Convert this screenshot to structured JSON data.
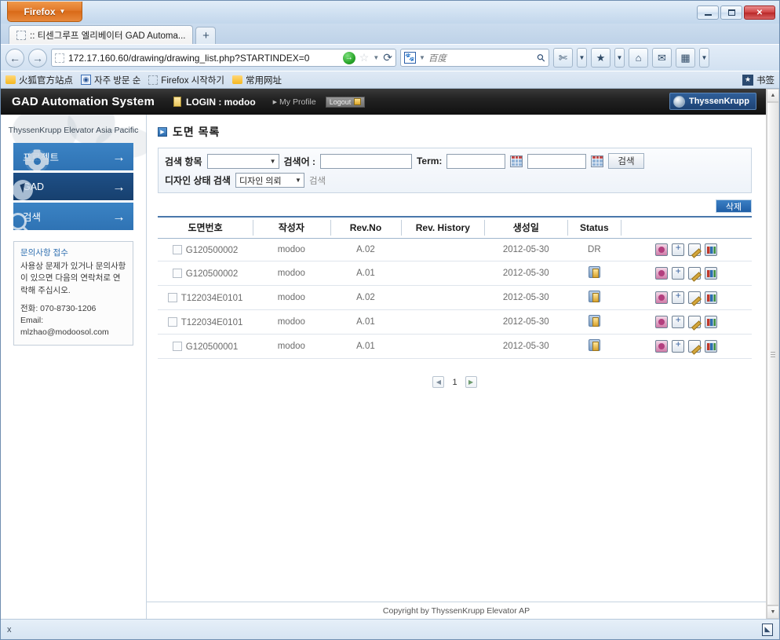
{
  "browser": {
    "app_button": "Firefox",
    "tab_title": ":: 티센그루프 엘리베이터 GAD Automa...",
    "new_tab_label": "+",
    "url": "172.17.160.60/drawing/drawing_list.php?STARTINDEX=0",
    "search_engine": "baidu",
    "search_placeholder": "百度",
    "bookmarks": [
      {
        "label": "火狐官方站点",
        "icon": "folder-icon"
      },
      {
        "label": "자주 방문 순",
        "icon": "bookmark-icon"
      },
      {
        "label": "Firefox 시작하기",
        "icon": "page-icon"
      },
      {
        "label": "常用网址",
        "icon": "folder-icon"
      }
    ],
    "bookmarks_right_label": "书签",
    "window_buttons": {
      "minimize": "—",
      "maximize": "❐",
      "close": "✕"
    }
  },
  "appbar": {
    "title": "GAD Automation System",
    "login_label": "LOGIN : modoo",
    "my_profile": "My Profile",
    "logout": "Logout",
    "brand": "ThyssenKrupp"
  },
  "sidebar": {
    "caption": "ThyssenKrupp Elevator Asia Pacific",
    "items": [
      {
        "label": "프로젝트",
        "icon": "gear-icon",
        "active": false
      },
      {
        "label": "GAD",
        "icon": "cursor-icon",
        "active": true
      },
      {
        "label": "검색",
        "icon": "magnifier-icon",
        "active": false
      }
    ],
    "info": {
      "title": "문의사항 접수",
      "body": "사용상 문제가 있거나 문의사항이 있으면 다음의 연락처로 연락해 주십시오.",
      "phone": "전화: 070-8730-1206",
      "email": "Email: mlzhao@modoosol.com"
    }
  },
  "main": {
    "page_title": "도면 목록",
    "search_form": {
      "field_label": "검색 항목",
      "field_value": "",
      "keyword_label": "검색어 :",
      "keyword_value": "",
      "term_label": "Term:",
      "term_from": "",
      "term_to": "",
      "search_button": "검색",
      "design_state_label": "디자인 상태 검색",
      "design_state_value": "디자인 의뢰",
      "design_state_search": "검색"
    },
    "delete_button": "삭제",
    "table": {
      "columns": [
        "도면번호",
        "작성자",
        "Rev.No",
        "Rev. History",
        "생성일",
        "Status",
        ""
      ],
      "rows": [
        {
          "checked": false,
          "drawing_no": "G120500002",
          "author": "modoo",
          "rev_no": "A.02",
          "rev_history": "",
          "created": "2012-05-30",
          "status_text": "DR",
          "status_icon": false
        },
        {
          "checked": false,
          "drawing_no": "G120500002",
          "author": "modoo",
          "rev_no": "A.01",
          "rev_history": "",
          "created": "2012-05-30",
          "status_text": "",
          "status_icon": true
        },
        {
          "checked": false,
          "drawing_no": "T122034E0101",
          "author": "modoo",
          "rev_no": "A.02",
          "rev_history": "",
          "created": "2012-05-30",
          "status_text": "",
          "status_icon": true
        },
        {
          "checked": false,
          "drawing_no": "T122034E0101",
          "author": "modoo",
          "rev_no": "A.01",
          "rev_history": "",
          "created": "2012-05-30",
          "status_text": "",
          "status_icon": true
        },
        {
          "checked": false,
          "drawing_no": "G120500001",
          "author": "modoo",
          "rev_no": "A.01",
          "rev_history": "",
          "created": "2012-05-30",
          "status_text": "",
          "status_icon": true
        }
      ],
      "row_actions": [
        "download-icon",
        "copy-icon",
        "edit-icon",
        "chart-icon"
      ]
    },
    "pager": {
      "prev": "◀",
      "page": "1",
      "next": "▶"
    },
    "footer": "Copyright by ThyssenKrupp Elevator AP"
  },
  "statusbar": {
    "text": "x",
    "resizer": "◣"
  }
}
